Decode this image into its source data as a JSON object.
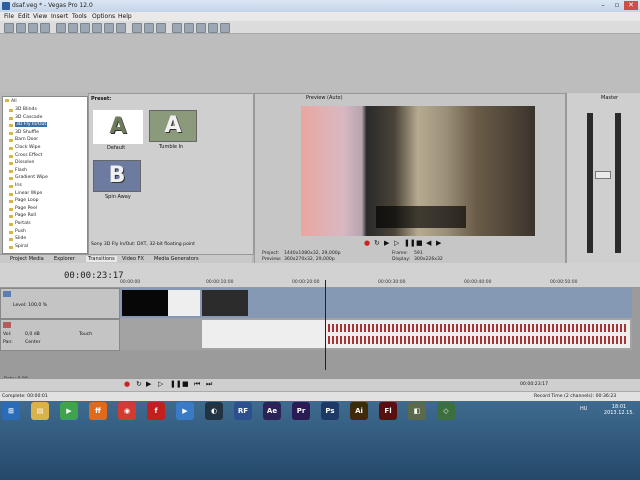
{
  "window": {
    "title": "dsaf.veg * - Vegas Pro 12.0"
  },
  "menu": [
    "File",
    "Edit",
    "View",
    "Insert",
    "Tools",
    "Options",
    "Help"
  ],
  "tree": {
    "root": "All",
    "items": [
      "3D Blinds",
      "3D Cascade",
      "3D Fly In/Out",
      "3D Shuffle",
      "Barn Door",
      "Clock Wipe",
      "Cross Effect",
      "Dissolve",
      "Flash",
      "Gradient Wipe",
      "Iris",
      "Linear Wipe",
      "Page Loop",
      "Page Peel",
      "Page Roll",
      "Portals",
      "Push",
      "Slide",
      "Spiral"
    ],
    "selected": "3D Fly In/Out"
  },
  "presets": {
    "label": "Preset:",
    "items": [
      {
        "letter": "A",
        "name": "Default"
      },
      {
        "letter": "A",
        "name": "Tumble In"
      },
      {
        "letter": "B",
        "name": "Spin Away"
      }
    ],
    "description": "Sony 3D Fly In/Out: DXT, 32-bit floating point"
  },
  "pane_tabs": [
    "Project Media",
    "Explorer",
    "Transitions",
    "Video FX",
    "Media Generators"
  ],
  "active_pane_tab": "Transitions",
  "preview": {
    "mode": "Preview (Auto)",
    "info": {
      "project": "Project:",
      "project_val": "1440x1080x32, 29,000p",
      "preview": "Preview:",
      "preview_val": "360x270x32, 29,000p",
      "frame": "Frame:",
      "frame_val": "591",
      "display": "Display:",
      "display_val": "300x226x32"
    }
  },
  "master": {
    "label": "Master"
  },
  "timeline": {
    "timecode": "00:00:23:17",
    "ruler": [
      "00:00:00",
      "00:00:10:00",
      "00:00:20:00",
      "00:00:30:00",
      "00:00:40:00",
      "00:00:50:00"
    ],
    "video_track": {
      "level": "Level: 100,0 %"
    },
    "audio_track": {
      "vol": "Vol:",
      "vol_val": "0,0 dB",
      "pan": "Pan:",
      "pan_val": "Center",
      "touch": "Touch"
    },
    "rate": "Rate: 0,00",
    "end_timecode": "00:00:23:17"
  },
  "status": {
    "left": "Complete: 00:00:01",
    "record": "Record Time (2 channels): 00:36:23"
  },
  "taskbar": {
    "lang": "HU",
    "time": "18:01",
    "date": "2013.12.15.",
    "apps": [
      {
        "name": "start",
        "color": "#2b6cb8",
        "label": "⊞"
      },
      {
        "name": "explorer",
        "color": "#d9b24a",
        "label": "▤"
      },
      {
        "name": "media",
        "color": "#3fa34d",
        "label": "▶"
      },
      {
        "name": "firefox",
        "color": "#e06a1b",
        "label": "ff"
      },
      {
        "name": "chrome",
        "color": "#d23b30",
        "label": "◉"
      },
      {
        "name": "flash",
        "color": "#c41f1f",
        "label": "f"
      },
      {
        "name": "vegas",
        "color": "#3a7bc8",
        "label": "▶"
      },
      {
        "name": "app",
        "color": "#223344",
        "label": "◐"
      },
      {
        "name": "rf",
        "color": "#2d4f8f",
        "label": "RF"
      },
      {
        "name": "ae",
        "color": "#2a2356",
        "label": "Ae"
      },
      {
        "name": "pr",
        "color": "#2b1b55",
        "label": "Pr"
      },
      {
        "name": "ps",
        "color": "#1d3a66",
        "label": "Ps"
      },
      {
        "name": "ai",
        "color": "#3f2a0b",
        "label": "Ai"
      },
      {
        "name": "fl",
        "color": "#5a0f0f",
        "label": "Fl"
      },
      {
        "name": "app2",
        "color": "#5a6a4a",
        "label": "◧"
      },
      {
        "name": "app3",
        "color": "#3d6e3d",
        "label": "◇"
      }
    ]
  }
}
